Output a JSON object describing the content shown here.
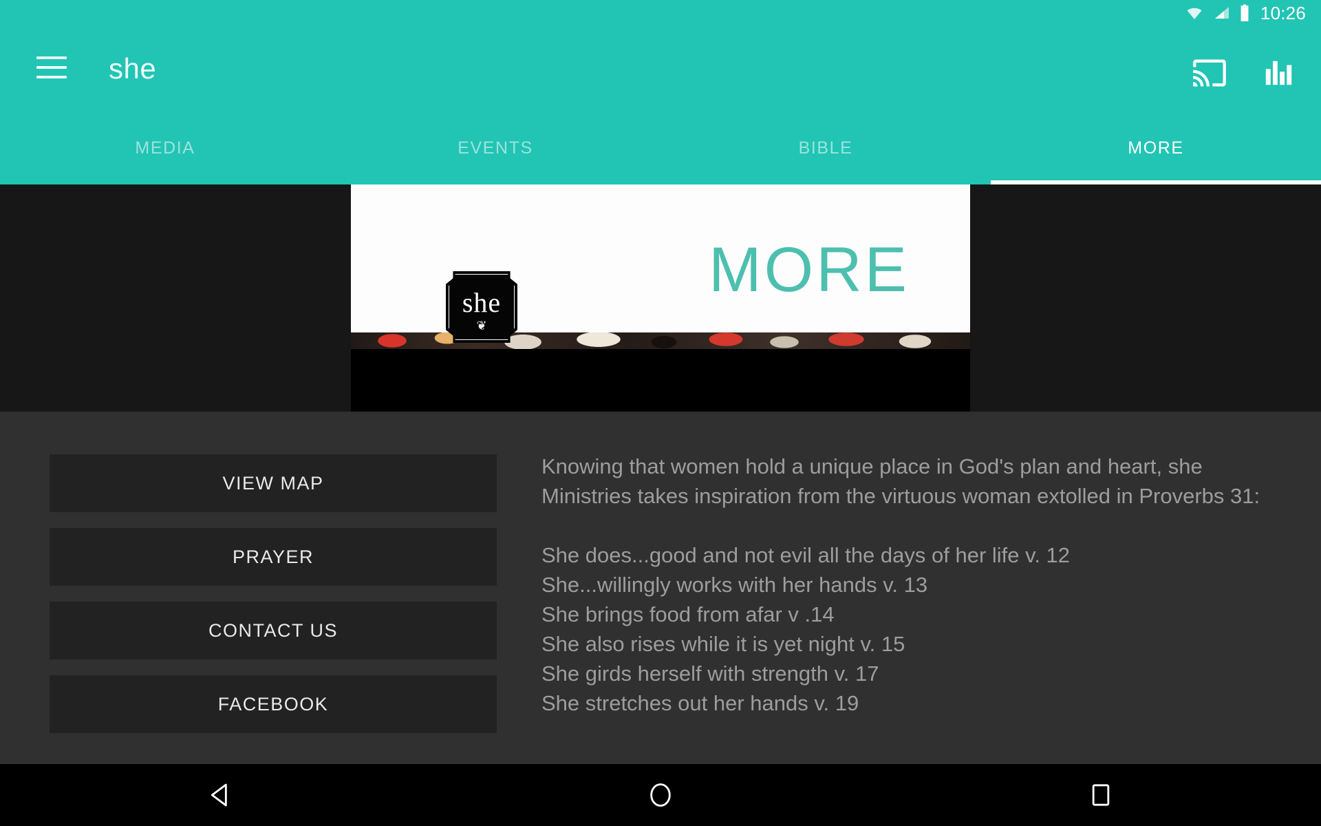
{
  "status_bar": {
    "time": "10:26",
    "icons": [
      "wifi-icon",
      "cellular-signal-icon",
      "battery-icon"
    ]
  },
  "app_bar": {
    "menu_icon": "hamburger-menu-icon",
    "title": "she",
    "actions": [
      {
        "icon": "cast-icon",
        "name": "cast-button"
      },
      {
        "icon": "equalizer-icon",
        "name": "equalizer-button"
      }
    ]
  },
  "tabs": {
    "items": [
      {
        "label": "MEDIA",
        "active": false
      },
      {
        "label": "EVENTS",
        "active": false
      },
      {
        "label": "BIBLE",
        "active": false
      },
      {
        "label": "MORE",
        "active": true
      }
    ],
    "active_index": 3
  },
  "hero": {
    "headline": "MORE",
    "badge_text": "she",
    "badge_ornament": "❦",
    "accent_color": "#4dbfae"
  },
  "buttons": [
    {
      "label": "VIEW MAP",
      "name": "view-map-button"
    },
    {
      "label": "PRAYER",
      "name": "prayer-button"
    },
    {
      "label": "CONTACT US",
      "name": "contact-us-button"
    },
    {
      "label": "FACEBOOK",
      "name": "facebook-button"
    }
  ],
  "description": {
    "intro": "Knowing that women hold a unique place in God's plan and heart, she Ministries takes inspiration from the virtuous woman extolled in Proverbs 31:",
    "verses": [
      "She does...good and not evil all the days of her life v. 12",
      "She...willingly works with her hands v. 13",
      "She brings food from afar v .14",
      "She also rises while it is yet night v. 15",
      "She girds herself with strength v. 17",
      "She stretches out her hands v. 19"
    ]
  },
  "nav_bar": {
    "buttons": [
      {
        "icon": "back-triangle-icon",
        "name": "back-button"
      },
      {
        "icon": "home-circle-icon",
        "name": "home-button"
      },
      {
        "icon": "recents-square-icon",
        "name": "recents-button"
      }
    ]
  },
  "theme": {
    "primary": "#22c4b4",
    "background": "#303030",
    "button_bg": "#222222",
    "text_muted": "#9d9d9d"
  }
}
